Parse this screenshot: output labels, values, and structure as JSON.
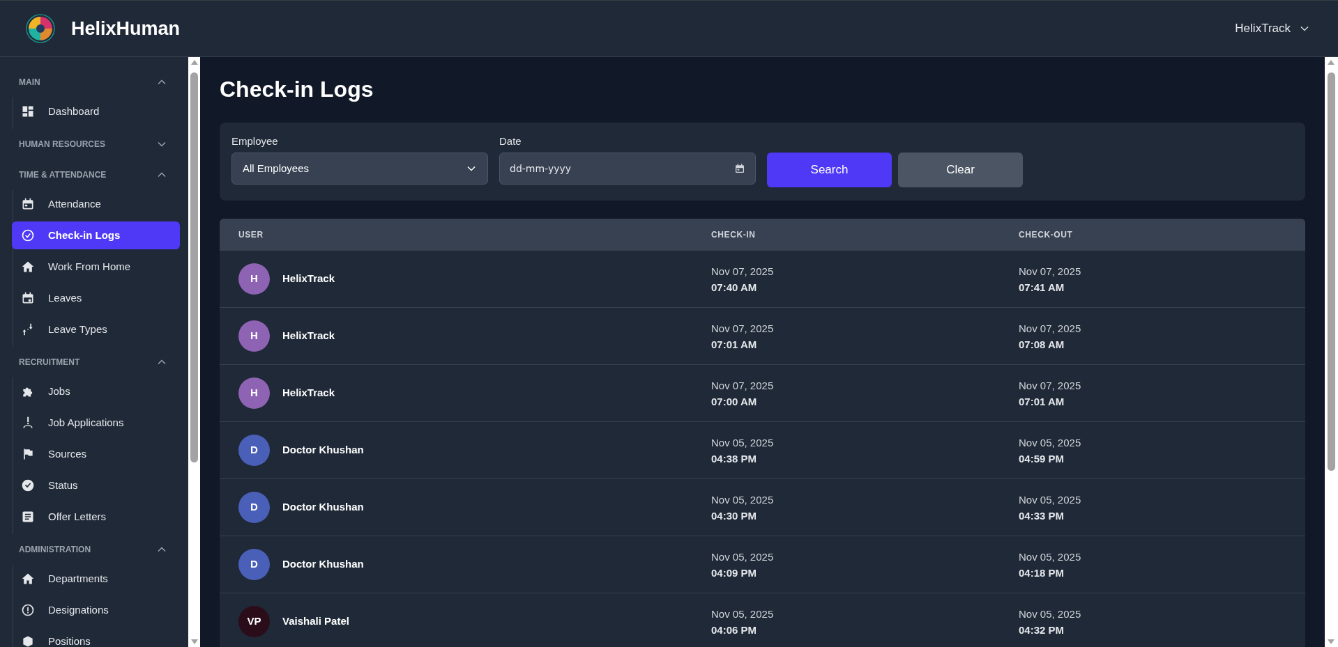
{
  "header": {
    "brand": "HelixHuman",
    "user_menu": "HelixTrack"
  },
  "sidebar": {
    "sections": [
      {
        "title": "MAIN",
        "expanded": true,
        "items": [
          {
            "label": "Dashboard",
            "selected": false
          }
        ]
      },
      {
        "title": "HUMAN RESOURCES",
        "expanded": false
      },
      {
        "title": "TIME & ATTENDANCE",
        "expanded": true,
        "items": [
          {
            "label": "Attendance",
            "selected": false
          },
          {
            "label": "Check-in Logs",
            "selected": true
          },
          {
            "label": "Work From Home",
            "selected": false
          },
          {
            "label": "Leaves",
            "selected": false
          },
          {
            "label": "Leave Types",
            "selected": false
          }
        ]
      },
      {
        "title": "RECRUITMENT",
        "expanded": true,
        "items": [
          {
            "label": "Jobs",
            "selected": false
          },
          {
            "label": "Job Applications",
            "selected": false
          },
          {
            "label": "Sources",
            "selected": false
          },
          {
            "label": "Status",
            "selected": false
          },
          {
            "label": "Offer Letters",
            "selected": false
          }
        ]
      },
      {
        "title": "ADMINISTRATION",
        "expanded": true,
        "items": [
          {
            "label": "Departments",
            "selected": false
          },
          {
            "label": "Designations",
            "selected": false
          },
          {
            "label": "Positions",
            "selected": false
          }
        ]
      }
    ]
  },
  "page": {
    "title": "Check-in Logs"
  },
  "filters": {
    "employee_label": "Employee",
    "employee_value": "All Employees",
    "date_label": "Date",
    "date_placeholder": "dd-mm-yyyy",
    "buttons": [
      {
        "label": "Search",
        "kind": "primary"
      },
      {
        "label": "Clear",
        "kind": "secondary"
      }
    ]
  },
  "table": {
    "columns": [
      "USER",
      "CHECK-IN",
      "CHECK-OUT"
    ],
    "rows": [
      {
        "initials": "H",
        "color": "#8e63b4",
        "user": "HelixTrack",
        "check_in_date": "Nov 07, 2025",
        "check_in_time": "07:40 AM",
        "check_out_date": "Nov 07, 2025",
        "check_out_time": "07:41 AM"
      },
      {
        "initials": "H",
        "color": "#8e63b4",
        "user": "HelixTrack",
        "check_in_date": "Nov 07, 2025",
        "check_in_time": "07:01 AM",
        "check_out_date": "Nov 07, 2025",
        "check_out_time": "07:08 AM"
      },
      {
        "initials": "H",
        "color": "#8e63b4",
        "user": "HelixTrack",
        "check_in_date": "Nov 07, 2025",
        "check_in_time": "07:00 AM",
        "check_out_date": "Nov 07, 2025",
        "check_out_time": "07:01 AM"
      },
      {
        "initials": "D",
        "color": "#4a5fb8",
        "user": "Doctor Khushan",
        "check_in_date": "Nov 05, 2025",
        "check_in_time": "04:38 PM",
        "check_out_date": "Nov 05, 2025",
        "check_out_time": "04:59 PM"
      },
      {
        "initials": "D",
        "color": "#4a5fb8",
        "user": "Doctor Khushan",
        "check_in_date": "Nov 05, 2025",
        "check_in_time": "04:30 PM",
        "check_out_date": "Nov 05, 2025",
        "check_out_time": "04:33 PM"
      },
      {
        "initials": "D",
        "color": "#4a5fb8",
        "user": "Doctor Khushan",
        "check_in_date": "Nov 05, 2025",
        "check_in_time": "04:09 PM",
        "check_out_date": "Nov 05, 2025",
        "check_out_time": "04:18 PM"
      },
      {
        "initials": "VP",
        "color": "#2b0d1a",
        "user": "Vaishali Patel",
        "check_in_date": "Nov 05, 2025",
        "check_in_time": "04:06 PM",
        "check_out_date": "Nov 05, 2025",
        "check_out_time": "04:32 PM"
      }
    ]
  }
}
